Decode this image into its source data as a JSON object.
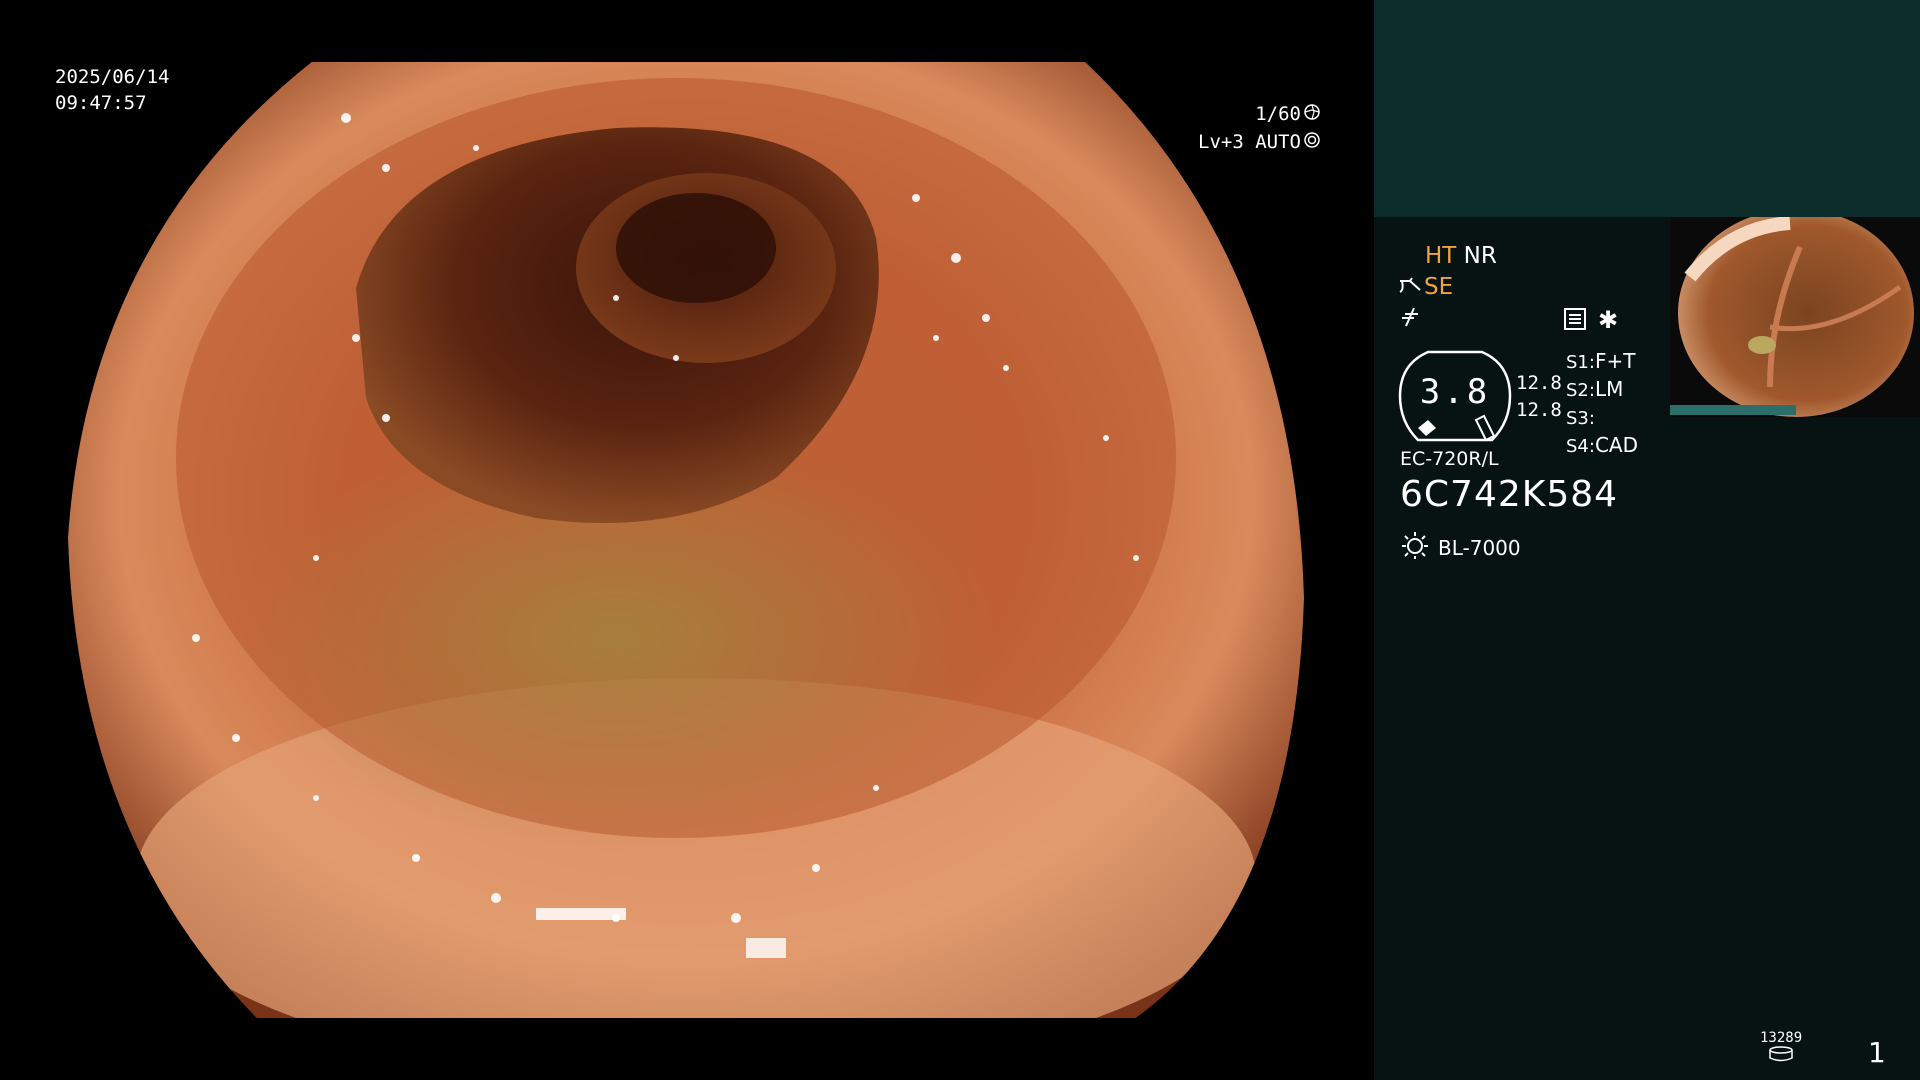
{
  "osd": {
    "date": "2025/06/14",
    "time": "09:47:57",
    "shutter": "1/60",
    "iris_mode": "Lv+3 AUTO"
  },
  "settings": {
    "ht": "HT",
    "nr": "NR",
    "se": "SE",
    "gauge_value": "3.8",
    "side_value_1": "12.8",
    "side_value_2": "12.8",
    "s1_label": "S1:",
    "s1_value": "F+T",
    "s2_label": "S2:",
    "s2_value": "LM",
    "s3_label": "S3:",
    "s3_value": "",
    "s4_label": "S4:",
    "s4_value": "CAD"
  },
  "scope": {
    "model": "EC-720R/L",
    "serial": "6C742K584",
    "light_source": "BL-7000"
  },
  "storage": {
    "count": "13289",
    "page": "1"
  },
  "icons": [
    "shutter-icon",
    "iris-icon",
    "enhance-icon",
    "freeze-icon",
    "menu-icon",
    "asterisk-icon",
    "light-source-icon",
    "storage-icon"
  ],
  "colors": {
    "accent_orange": "#f2a33a",
    "panel_top": "#0c2b2b",
    "panel_main": "#071313"
  }
}
